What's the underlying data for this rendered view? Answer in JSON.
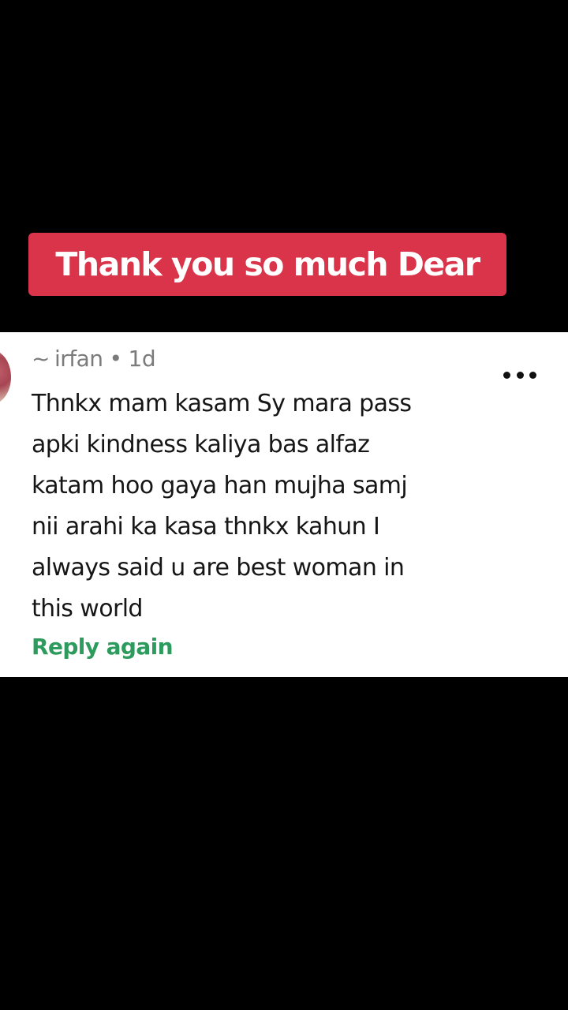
{
  "banner": {
    "text": "Thank you so much Dear",
    "color": "#d9344a"
  },
  "comment": {
    "prefix": "~",
    "username": "irfan",
    "separator": "•",
    "time": "1d",
    "more_icon": "more-horizontal-icon",
    "lines": [
      "Thnkx mam kasam Sy mara pass",
      "apki kindness kaliya bas alfaz",
      "katam hoo gaya han mujha samj",
      "nii arahi ka kasa thnkx kahun I",
      "always said u are best woman in",
      "this world"
    ],
    "reply_label": "Reply again",
    "reply_color": "#2e9b5e"
  }
}
